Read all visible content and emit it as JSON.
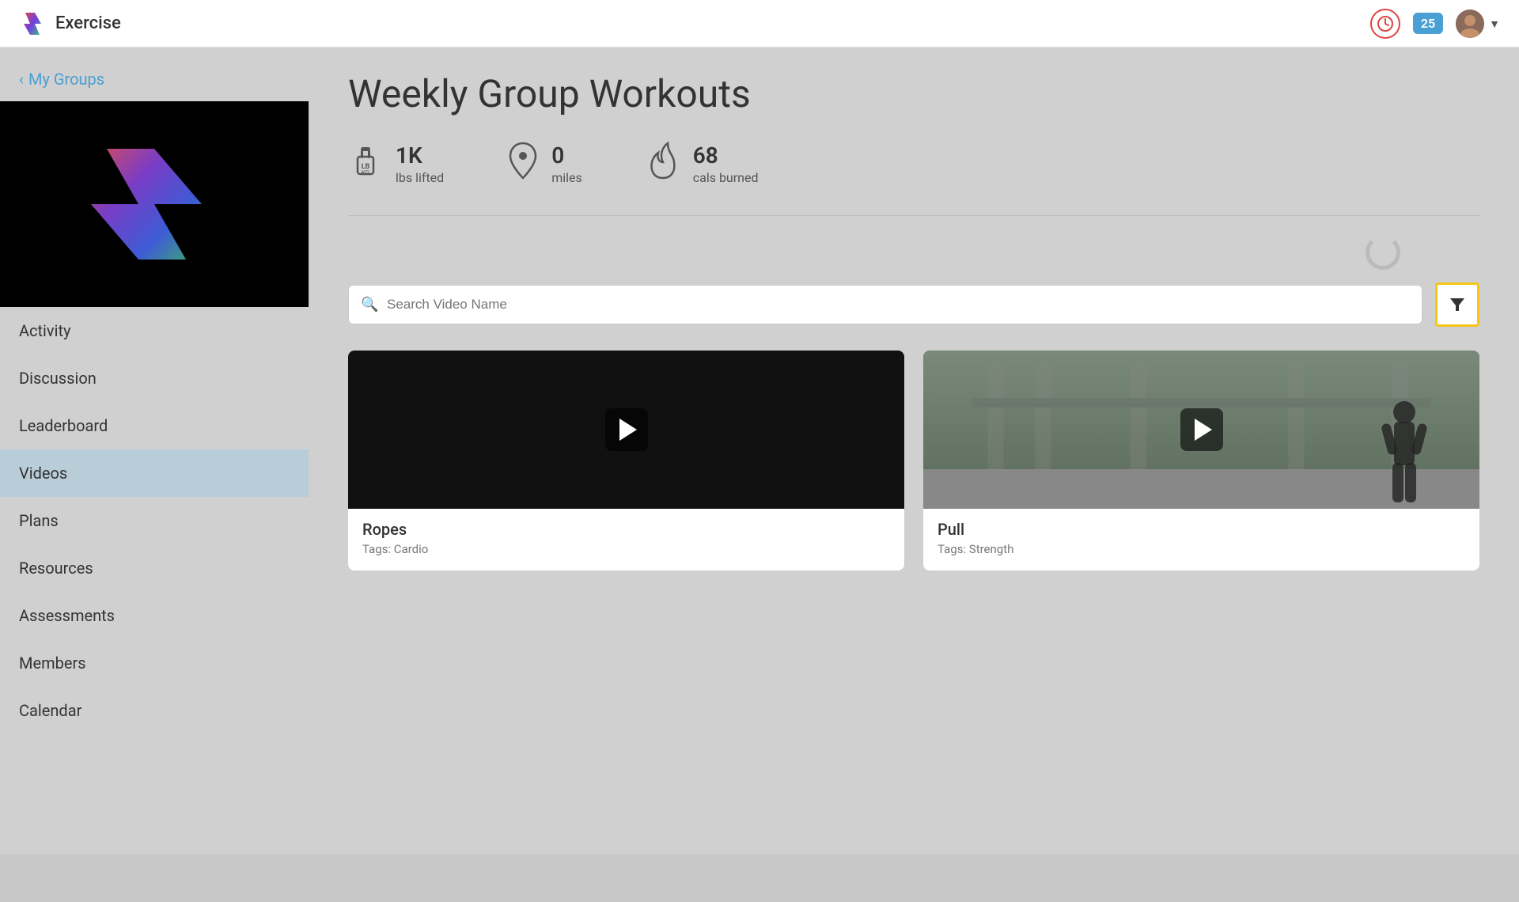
{
  "app": {
    "title": "Exercise",
    "logo_alt": "Exercise logo"
  },
  "header": {
    "notification_count": "25",
    "clock_label": "Clock",
    "avatar_label": "User avatar"
  },
  "sidebar": {
    "back_label": "My Groups",
    "nav_items": [
      {
        "id": "activity",
        "label": "Activity",
        "active": false
      },
      {
        "id": "discussion",
        "label": "Discussion",
        "active": false
      },
      {
        "id": "leaderboard",
        "label": "Leaderboard",
        "active": false
      },
      {
        "id": "videos",
        "label": "Videos",
        "active": true
      },
      {
        "id": "plans",
        "label": "Plans",
        "active": false
      },
      {
        "id": "resources",
        "label": "Resources",
        "active": false
      },
      {
        "id": "assessments",
        "label": "Assessments",
        "active": false
      },
      {
        "id": "members",
        "label": "Members",
        "active": false
      },
      {
        "id": "calendar",
        "label": "Calendar",
        "active": false
      }
    ]
  },
  "main": {
    "group_title": "Weekly Group Workouts",
    "stats": [
      {
        "icon": "weight",
        "value": "1K",
        "label": "lbs lifted"
      },
      {
        "icon": "location",
        "value": "0",
        "label": "miles"
      },
      {
        "icon": "fire",
        "value": "68",
        "label": "cals burned"
      }
    ],
    "search_placeholder": "Search Video Name",
    "filter_button_label": "Filter",
    "videos": [
      {
        "id": "ropes",
        "name": "Ropes",
        "tags": "Tags: Cardio",
        "thumb_type": "dark"
      },
      {
        "id": "pull",
        "name": "Pull",
        "tags": "Tags: Strength",
        "thumb_type": "scene"
      }
    ]
  }
}
